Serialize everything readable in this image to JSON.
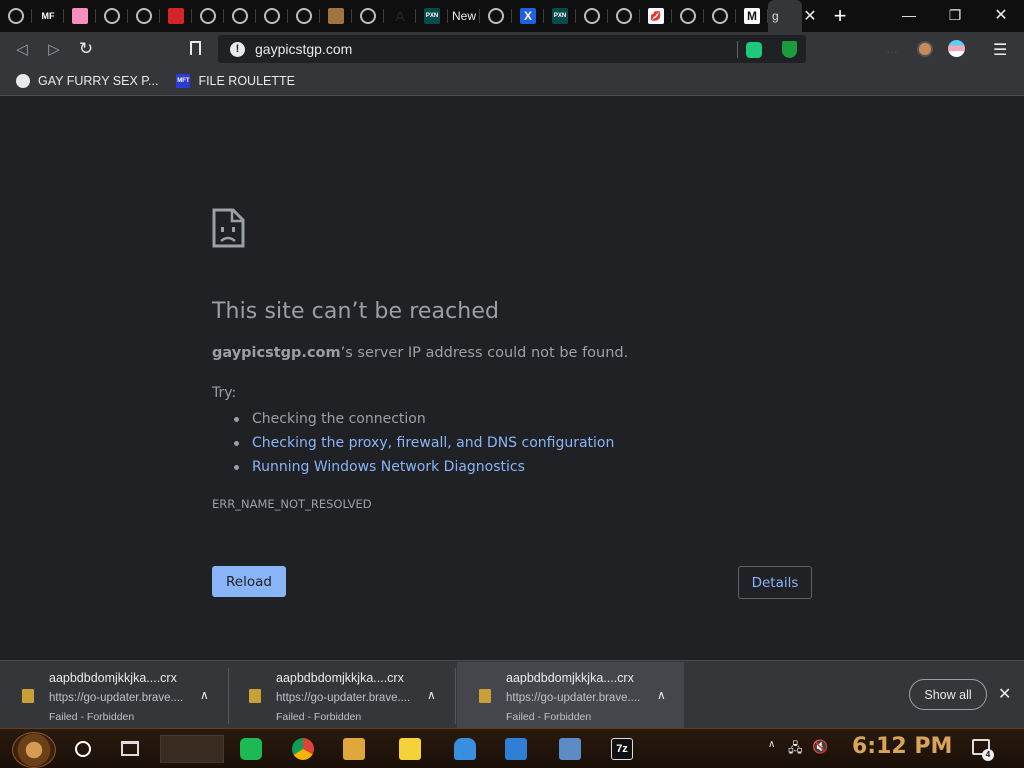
{
  "browser": {
    "tabs": [
      {
        "icon": "globe-icon",
        "label": ""
      },
      {
        "icon": "mf-logo-icon",
        "label": "MF"
      },
      {
        "icon": "pink-badge-icon",
        "label": ""
      },
      {
        "icon": "globe-icon",
        "label": ""
      },
      {
        "icon": "globe-icon",
        "label": ""
      },
      {
        "icon": "red-logo-icon",
        "label": ""
      },
      {
        "icon": "globe-icon",
        "label": ""
      },
      {
        "icon": "globe-icon",
        "label": ""
      },
      {
        "icon": "globe-icon",
        "label": ""
      },
      {
        "icon": "globe-icon",
        "label": ""
      },
      {
        "icon": "photo-icon",
        "label": ""
      },
      {
        "icon": "globe-icon",
        "label": ""
      },
      {
        "icon": "letter-a-icon",
        "label": "A"
      },
      {
        "icon": "pxn-logo-icon",
        "label": "PXN"
      },
      {
        "icon": "text-icon",
        "label": "New"
      },
      {
        "icon": "globe-icon",
        "label": ""
      },
      {
        "icon": "x-logo-icon",
        "label": "X"
      },
      {
        "icon": "pxn-logo-icon",
        "label": "PXN"
      },
      {
        "icon": "globe-icon",
        "label": ""
      },
      {
        "icon": "globe-icon",
        "label": ""
      },
      {
        "icon": "lips-icon",
        "label": ""
      },
      {
        "icon": "globe-icon",
        "label": ""
      },
      {
        "icon": "globe-icon",
        "label": ""
      },
      {
        "icon": "m-logo-icon",
        "label": "M"
      }
    ],
    "active_tab_letter": "g",
    "url": "gaypicstgp.com",
    "bookmarks": [
      {
        "icon": "globe-icon",
        "label": "GAY FURRY SEX P..."
      },
      {
        "icon": "mft-logo-icon",
        "label": "FILE ROULETTE"
      }
    ]
  },
  "error_page": {
    "title": "This site can’t be reached",
    "host": "gaypicstgp.com",
    "description_suffix": "’s server IP address could not be found.",
    "try_label": "Try:",
    "suggestions": [
      {
        "text": "Checking the connection",
        "link": false
      },
      {
        "text": "Checking the proxy, firewall, and DNS configuration",
        "link": true
      },
      {
        "text": "Running Windows Network Diagnostics",
        "link": true
      }
    ],
    "error_code": "ERR_NAME_NOT_RESOLVED",
    "reload_label": "Reload",
    "details_label": "Details"
  },
  "downloads": {
    "items": [
      {
        "name": "aapbdbdomjkkjka....crx",
        "url": "https://go-updater.brave....",
        "status": "Failed - Forbidden"
      },
      {
        "name": "aapbdbdomjkkjka....crx",
        "url": "https://go-updater.brave....",
        "status": "Failed - Forbidden"
      },
      {
        "name": "aapbdbdomjkkjka....crx",
        "url": "https://go-updater.brave....",
        "status": "Failed - Forbidden"
      }
    ],
    "show_all_label": "Show all"
  },
  "taskbar": {
    "clock": "6:12 PM",
    "notification_count": "4",
    "apps": [
      "app-icon",
      "chrome-icon",
      "file-explorer-icon",
      "sticky-notes-icon",
      "onedrive-icon",
      "mail-icon",
      "remote-desktop-icon",
      "7zip-icon"
    ],
    "app_7zip_label": "7z"
  },
  "colors": {
    "accent": "#8ab4f8",
    "page_background": "#202124",
    "text_muted": "#9aa0a6"
  }
}
